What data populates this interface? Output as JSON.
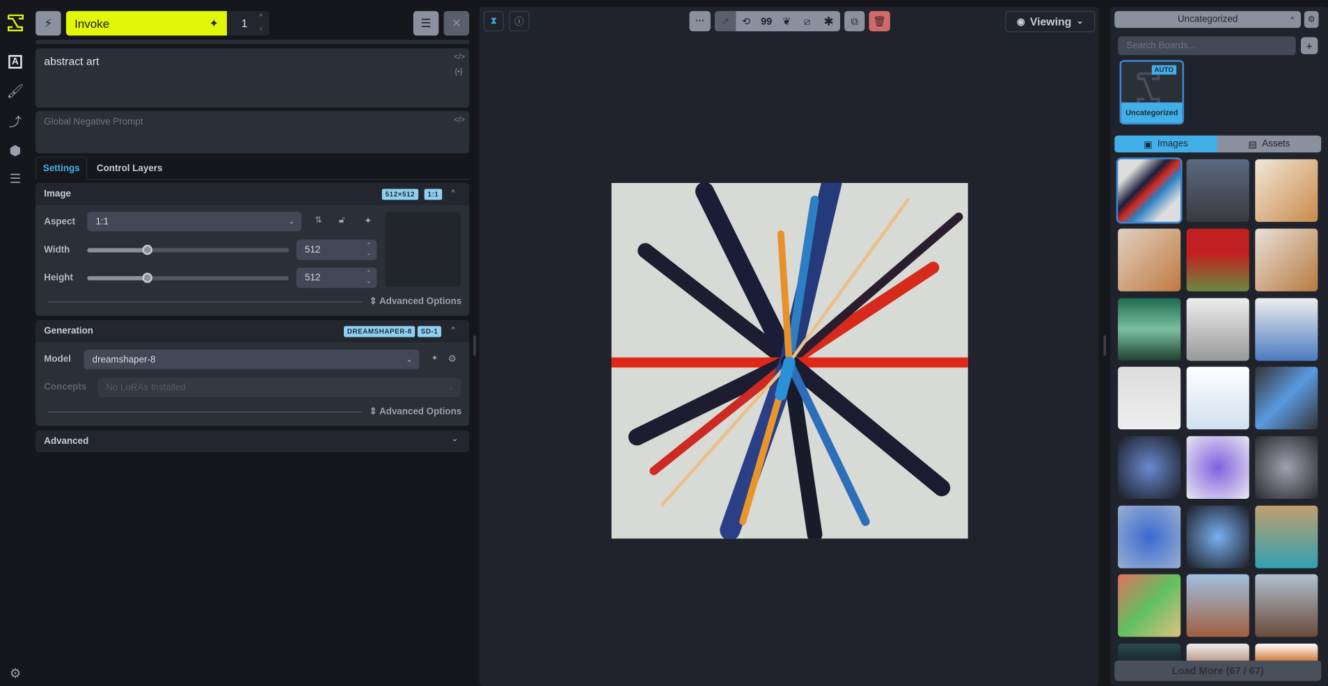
{
  "colors": {
    "accent": "#42b0e8",
    "invoke": "#e0f70a",
    "danger": "#d06a6a"
  },
  "rail": {
    "icons": [
      "invoke-logo",
      "text-to-image-icon",
      "canvas-brush-icon",
      "workflows-icon",
      "models-cube-icon",
      "queue-icon",
      "settings-gear-icon"
    ]
  },
  "top": {
    "invoke_label": "Invoke",
    "iterations": "1"
  },
  "prompt": {
    "positive": "abstract art",
    "negative_placeholder": "Global Negative Prompt"
  },
  "tabs": [
    {
      "label": "Settings",
      "active": true
    },
    {
      "label": "Control Layers",
      "active": false
    }
  ],
  "image_section": {
    "title": "Image",
    "badges": [
      "512×512",
      "1:1"
    ],
    "aspect_label": "Aspect",
    "aspect_value": "1:1",
    "width_label": "Width",
    "width_value": "512",
    "height_label": "Height",
    "height_value": "512",
    "slider_fraction": 0.3,
    "advanced": "Advanced Options"
  },
  "generation_section": {
    "title": "Generation",
    "badges": [
      "DREAMSHAPER-8",
      "SD-1"
    ],
    "model_label": "Model",
    "model_value": "dreamshaper-8",
    "concepts_label": "Concepts",
    "concepts_placeholder": "No LoRAs Installed",
    "advanced": "Advanced Options"
  },
  "advanced_section": {
    "title": "Advanced"
  },
  "viewer": {
    "mode": "Viewing",
    "toolbar_icons": [
      "more-icon",
      "recall-workflow-icon",
      "remix-icon",
      "recall-prompt-icon",
      "seed-icon",
      "ruler-size-icon",
      "asterisk-all-icon",
      "canvas-send-icon",
      "delete-icon"
    ]
  },
  "gallery": {
    "board": "Uncategorized",
    "search_placeholder": "Search Boards...",
    "board_card": {
      "name": "Uncategorized",
      "badge": "AUTO"
    },
    "tabs": [
      {
        "label": "Images",
        "active": true
      },
      {
        "label": "Assets",
        "active": false
      }
    ],
    "load_more": "Load More (67 / 67)"
  }
}
